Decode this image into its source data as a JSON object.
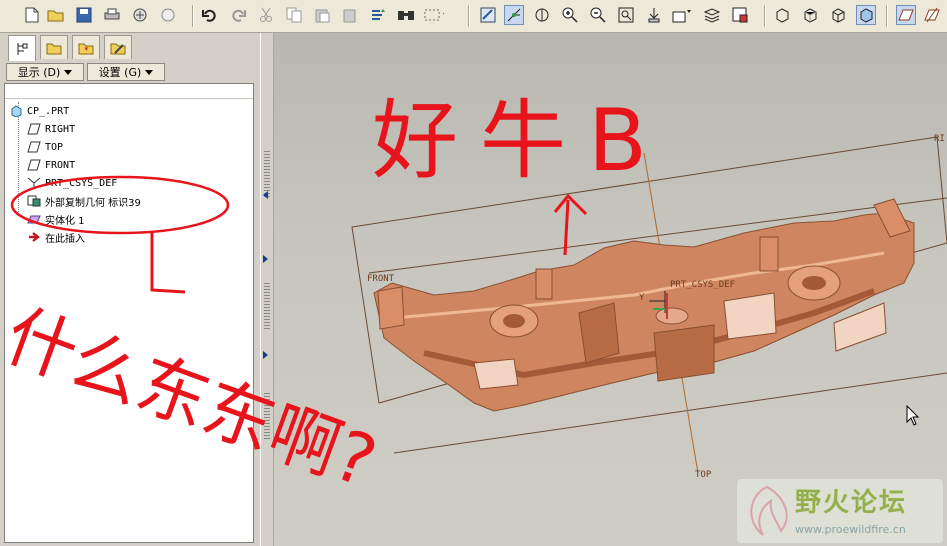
{
  "toolbar": {
    "buttons": [
      "new-icon",
      "open-icon",
      "save-icon",
      "print-icon",
      "send-icon",
      "mail-icon",
      "undo-icon",
      "redo-icon",
      "cut-icon",
      "copy-icon",
      "paste-icon",
      "paste-special-icon",
      "regenerate-icon",
      "find-icon",
      "select-box-icon",
      "repaint-icon",
      "spin-center-icon",
      "orient-icon",
      "zoom-in-icon",
      "zoom-out-icon",
      "refit-icon",
      "orient-view-icon",
      "named-views-icon",
      "layers-icon",
      "setup-icon",
      "wireframe-icon",
      "hidden-line-icon",
      "no-hidden-icon",
      "shading-icon",
      "datum-plane-display-icon",
      "datum-axis-display-icon"
    ]
  },
  "left_panel": {
    "tabs": [
      "model-tree-tab",
      "folder-tab",
      "favorites-tab",
      "tools-tab"
    ],
    "show_button": "显示 (D)",
    "settings_button": "设置 (G)",
    "tree": {
      "root": "CP_.PRT",
      "items": [
        {
          "label": "RIGHT",
          "icon": "datum-plane-icon"
        },
        {
          "label": "TOP",
          "icon": "datum-plane-icon"
        },
        {
          "label": "FRONT",
          "icon": "datum-plane-icon"
        },
        {
          "label": "PRT_CSYS_DEF",
          "icon": "coordinate-system-icon"
        },
        {
          "label": "外部复制几何 标识39",
          "icon": "external-copy-geometry-icon"
        },
        {
          "label": "实体化 1",
          "icon": "solidify-icon"
        },
        {
          "label": "在此插入",
          "icon": "insert-here-icon"
        }
      ]
    }
  },
  "viewport": {
    "datum_labels": {
      "right": "RI",
      "front": "FRONT",
      "top": "TOP",
      "csys": "PRT_CSYS_DEF",
      "y": "Y"
    },
    "part_color": "#cf8660",
    "datum_color": "#8a5a3a"
  },
  "annotations": {
    "top_text": "好牛B",
    "left_text": "什么东东啊?",
    "color": "#e8141c"
  },
  "watermark": {
    "title": "野火论坛",
    "url": "www.proewildfire.cn"
  }
}
